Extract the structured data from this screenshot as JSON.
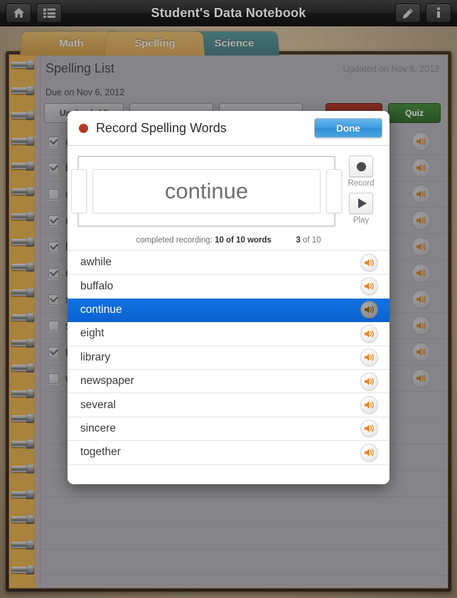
{
  "topbar": {
    "title": "Student's Data Notebook",
    "home_icon": "home-icon",
    "list_icon": "list-icon",
    "edit_icon": "pencil-icon",
    "info_icon": "info-icon"
  },
  "tabs": [
    {
      "label": "Math",
      "color": "#c9a460",
      "active": false
    },
    {
      "label": "Spelling",
      "color": "#c9a460",
      "active": true
    },
    {
      "label": "Science",
      "color": "#4f8487",
      "active": false
    }
  ],
  "sheet": {
    "title": "Spelling List",
    "updated": "Updated on Nov 6, 2012",
    "due": "Due on Nov 6, 2012",
    "toolbar": [
      {
        "label": "Uncheck All",
        "style": "plain"
      },
      {
        "label": "",
        "style": "plain"
      },
      {
        "label": "",
        "style": "plain"
      },
      {
        "label": "",
        "style": "red"
      },
      {
        "label": "Quiz",
        "style": "green"
      }
    ],
    "words": [
      {
        "text": "awhile",
        "checked": true
      },
      {
        "text": "buffalo",
        "checked": true
      },
      {
        "text": "continue",
        "checked": false
      },
      {
        "text": "eight",
        "checked": true
      },
      {
        "text": "library",
        "checked": true
      },
      {
        "text": "newspaper",
        "checked": true
      },
      {
        "text": "several",
        "checked": true
      },
      {
        "text": "sincere",
        "checked": false
      },
      {
        "text": "together",
        "checked": true
      },
      {
        "text": "written",
        "checked": false
      }
    ]
  },
  "modal": {
    "title": "Record Spelling Words",
    "done_label": "Done",
    "record_dot": "record-dot-icon",
    "current_word": "continue",
    "record_label": "Record",
    "play_label": "Play",
    "status_prefix": "completed recording:",
    "status_count": "10 of 10 words",
    "index_current": "3",
    "index_suffix": "of 10",
    "selected_index": 2,
    "words": [
      "awhile",
      "buffalo",
      "continue",
      "eight",
      "library",
      "newspaper",
      "several",
      "sincere",
      "together"
    ]
  },
  "colors": {
    "accent_blue": "#0a62cf",
    "speaker_orange": "#e8821e",
    "record_red": "#b03b22",
    "tab_gold": "#c9a460",
    "tab_teal": "#4f8487"
  }
}
